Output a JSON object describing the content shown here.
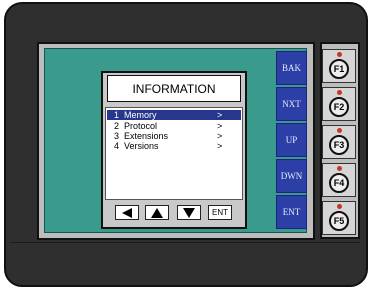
{
  "soft_keys": [
    "BAK",
    "NXT",
    "UP",
    "DWN",
    "ENT"
  ],
  "dialog": {
    "title": "INFORMATION",
    "menu_items": [
      {
        "label": "1  Memory",
        "arrow": ">",
        "selected": true
      },
      {
        "label": "2  Protocol",
        "arrow": ">",
        "selected": false
      },
      {
        "label": "3  Extensions",
        "arrow": ">",
        "selected": false
      },
      {
        "label": "4  Versions",
        "arrow": ">",
        "selected": false
      }
    ],
    "nav_buttons": [
      {
        "icon": "arrow-left-icon"
      },
      {
        "icon": "arrow-up-icon"
      },
      {
        "icon": "arrow-down-icon"
      },
      {
        "label": "ENT"
      }
    ]
  },
  "function_keys": [
    "F1",
    "F2",
    "F3",
    "F4",
    "F5"
  ],
  "colors": {
    "bezel": "#2f2f2f",
    "screen": "#3a9b8c",
    "soft_key": "#2b3fa6",
    "selection": "#26378c",
    "led": "#c0392b"
  }
}
